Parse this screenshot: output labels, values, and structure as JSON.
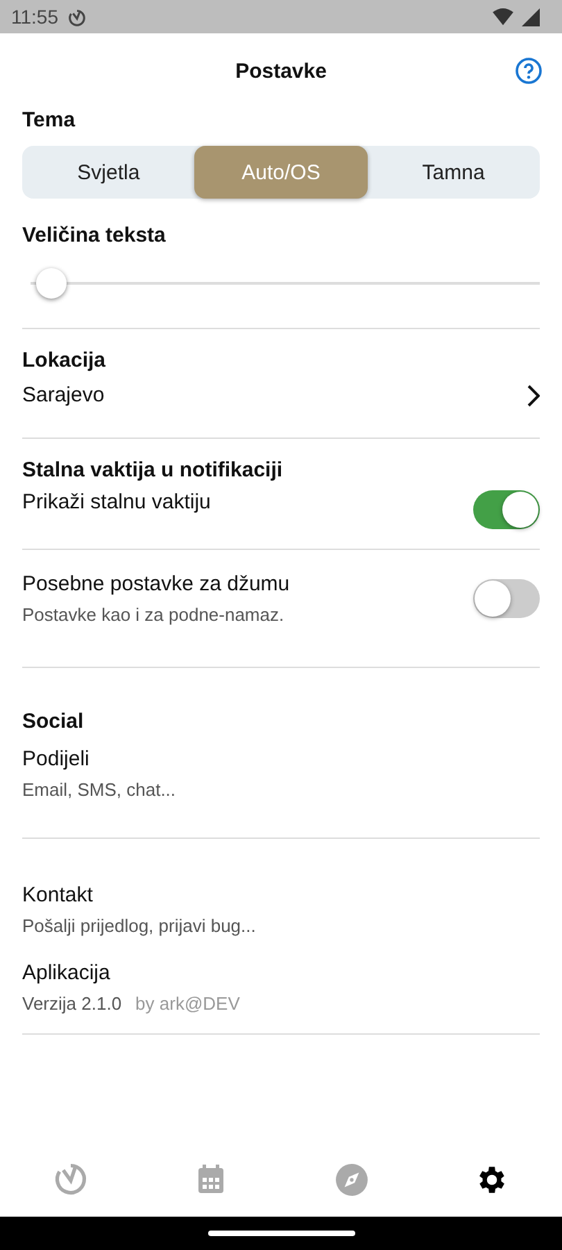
{
  "status_bar": {
    "time": "11:55"
  },
  "header": {
    "title": "Postavke"
  },
  "theme": {
    "label": "Tema",
    "options": [
      {
        "label": "Svjetla",
        "selected": false
      },
      {
        "label": "Auto/OS",
        "selected": true
      },
      {
        "label": "Tamna",
        "selected": false
      }
    ]
  },
  "text_size": {
    "label": "Veličina teksta",
    "level": 0.04
  },
  "location": {
    "label": "Lokacija",
    "value": "Sarajevo"
  },
  "notification": {
    "label": "Stalna vaktija u notifikaciji",
    "toggle_label": "Prikaži stalnu vaktiju",
    "on": true
  },
  "jumuah": {
    "label": "Posebne postavke za džumu",
    "description": "Postavke kao i za podne-namaz.",
    "on": false
  },
  "social": {
    "label": "Social",
    "item_title": "Podijeli",
    "item_subtitle": "Email, SMS, chat..."
  },
  "contact": {
    "title": "Kontakt",
    "subtitle": "Pošalji prijedlog, prijavi bug..."
  },
  "app": {
    "title": "Aplikacija",
    "version": "Verzija 2.1.0",
    "author": "by ark@DEV"
  },
  "bottom_nav": [
    {
      "kind": "timer",
      "selected": false
    },
    {
      "kind": "calendar",
      "selected": false
    },
    {
      "kind": "compass",
      "selected": false
    },
    {
      "kind": "settings",
      "selected": true
    }
  ]
}
